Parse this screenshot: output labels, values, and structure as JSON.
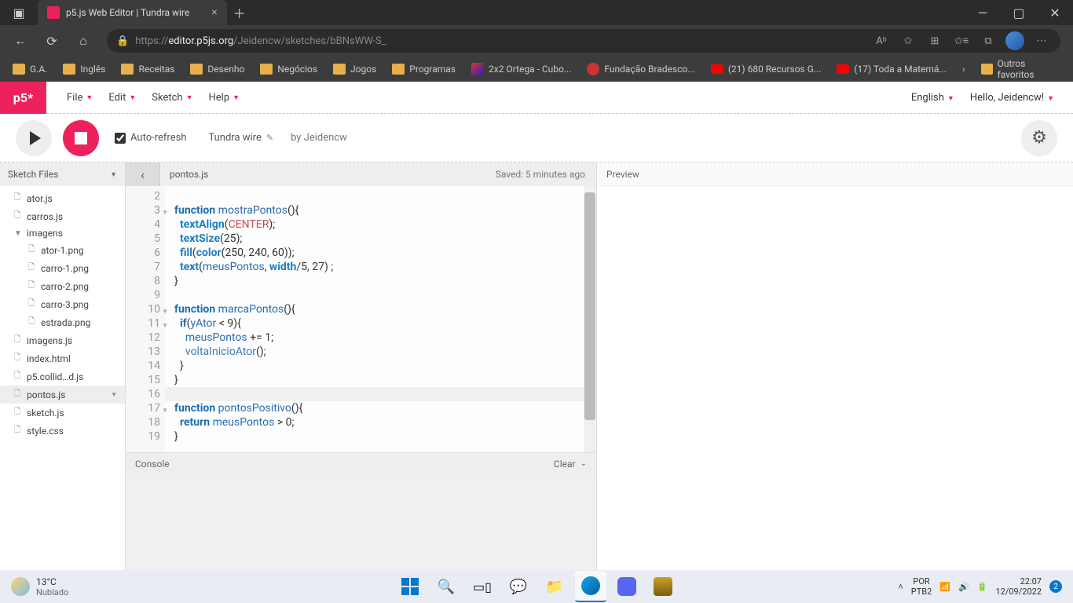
{
  "browser": {
    "tab_title": "p5.js Web Editor | Tundra wire",
    "url_prefix": "https://",
    "url_host": "editor.p5js.org",
    "url_path": "/Jeidencw/sketches/bBNsWW-S_",
    "bookmarks": [
      "G.A.",
      "Inglês",
      "Receitas",
      "Desenho",
      "Negócios",
      "Jogos",
      "Programas",
      "2x2 Ortega - Cubo...",
      "Fundação Bradesco...",
      "(21) 680 Recursos G...",
      "(17) Toda a Matemá..."
    ],
    "other_favorites": "Outros favoritos"
  },
  "p5": {
    "logo": "p5*",
    "menus": [
      "File",
      "Edit",
      "Sketch",
      "Help"
    ],
    "language": "English",
    "greeting": "Hello, Jeidencw!",
    "auto_refresh": "Auto-refresh",
    "sketch_name": "Tundra wire",
    "by_author": "by Jeidencw"
  },
  "sidebar": {
    "header": "Sketch Files",
    "files": [
      {
        "name": "ator.js",
        "icon": "file"
      },
      {
        "name": "carros.js",
        "icon": "file"
      },
      {
        "name": "imagens",
        "icon": "folder"
      },
      {
        "name": "ator-1.png",
        "icon": "file",
        "nested": true
      },
      {
        "name": "carro-1.png",
        "icon": "file",
        "nested": true
      },
      {
        "name": "carro-2.png",
        "icon": "file",
        "nested": true
      },
      {
        "name": "carro-3.png",
        "icon": "file",
        "nested": true
      },
      {
        "name": "estrada.png",
        "icon": "file",
        "nested": true
      },
      {
        "name": "imagens.js",
        "icon": "file"
      },
      {
        "name": "index.html",
        "icon": "file"
      },
      {
        "name": "p5.collid…d.js",
        "icon": "file"
      },
      {
        "name": "pontos.js",
        "icon": "file",
        "selected": true
      },
      {
        "name": "sketch.js",
        "icon": "file"
      },
      {
        "name": "style.css",
        "icon": "file"
      }
    ]
  },
  "editor": {
    "current_file": "pontos.js",
    "saved_text": "Saved: 5 minutes ago",
    "first_line_no": 2,
    "last_line_no": 19,
    "highlighted_line": 16,
    "fold_lines": [
      3,
      10,
      11,
      17
    ]
  },
  "console": {
    "label": "Console",
    "clear": "Clear"
  },
  "preview": {
    "label": "Preview"
  },
  "taskbar": {
    "temp": "13°C",
    "weather": "Nublado",
    "lang1": "POR",
    "lang2": "PTB2",
    "time": "22:07",
    "date": "12/09/2022",
    "notif_count": "2"
  }
}
